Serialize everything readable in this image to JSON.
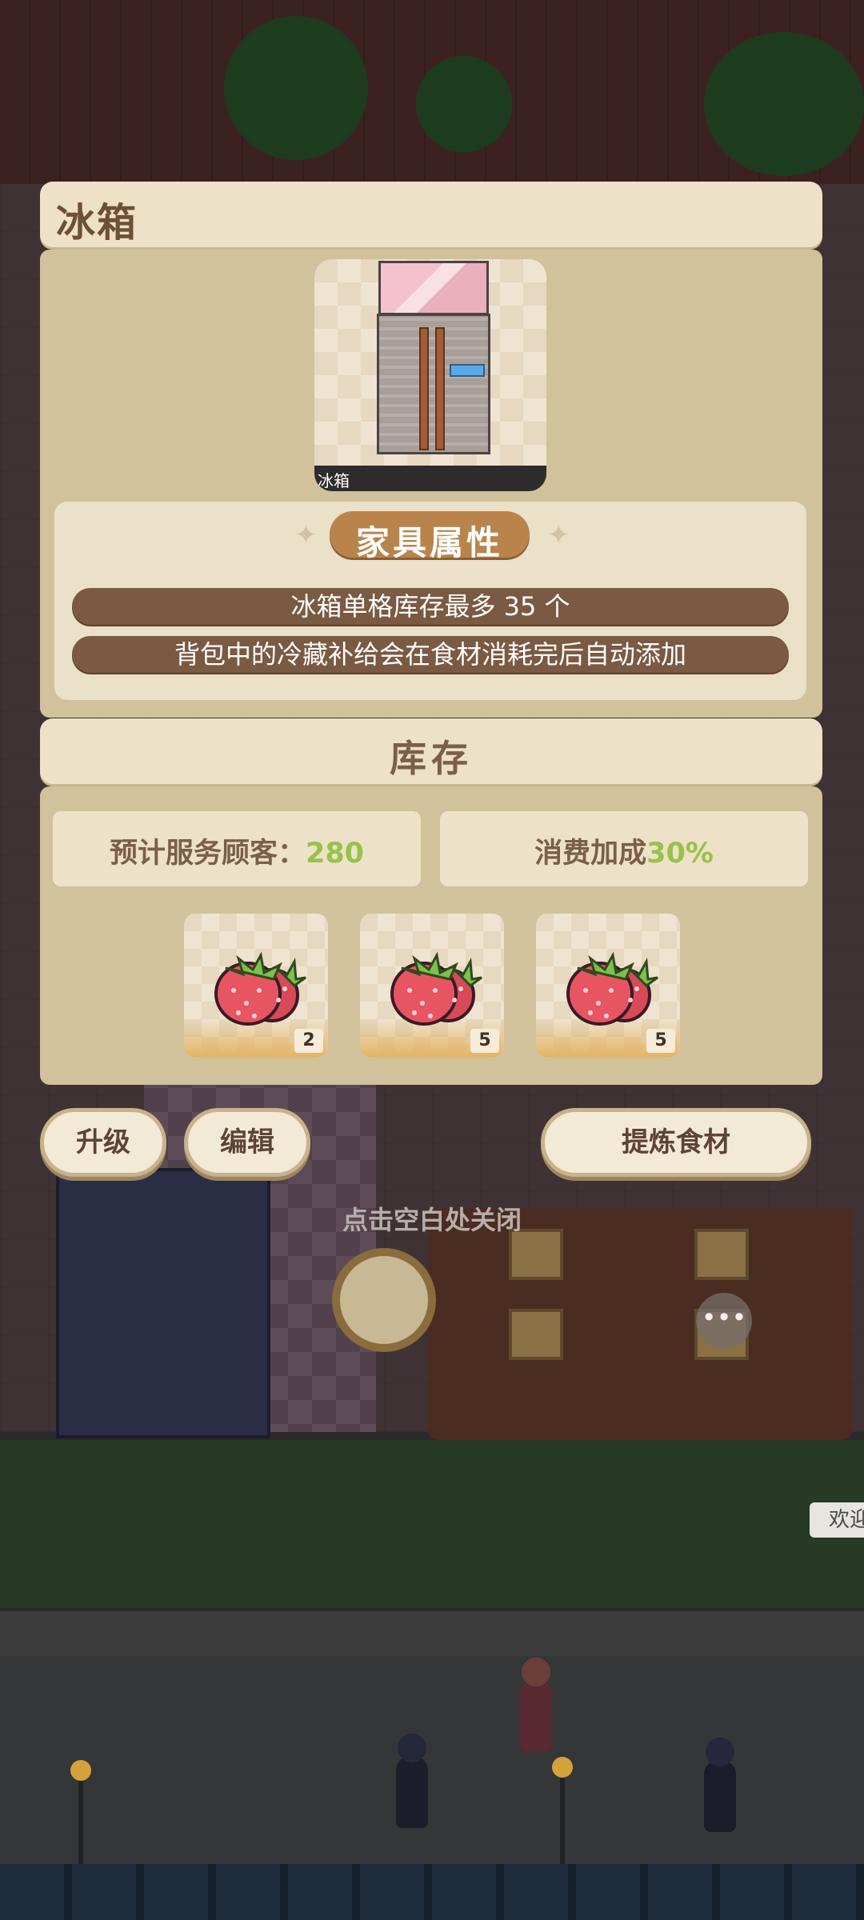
{
  "furniture": {
    "title": "冰箱",
    "preview_caption": "冰箱",
    "attributes_title": "家具属性",
    "attributes": [
      "冰箱单格库存最多 35 个",
      "背包中的冷藏补给会在食材消耗完后自动添加"
    ]
  },
  "inventory": {
    "title": "库存",
    "serve_label": "预计服务顾客：",
    "serve_value": "280",
    "bonus_label": "消费加成",
    "bonus_value": "30%",
    "value_color": "#97c24b",
    "items": [
      {
        "icon": "strawberry-icon",
        "count": "2"
      },
      {
        "icon": "strawberry-icon",
        "count": "5"
      },
      {
        "icon": "strawberry-icon",
        "count": "5"
      }
    ]
  },
  "actions": {
    "upgrade": "升级",
    "edit": "编辑",
    "refine": "提炼食材"
  },
  "hint": "点击空白处关闭",
  "more_button": "•••",
  "welcome_sign": "欢迎",
  "colors": {
    "panel_bg": "#d1c29c",
    "header_bg": "#ede1c7",
    "attr_row_bg": "#7a5a42",
    "title_pill": "#b9844c"
  }
}
